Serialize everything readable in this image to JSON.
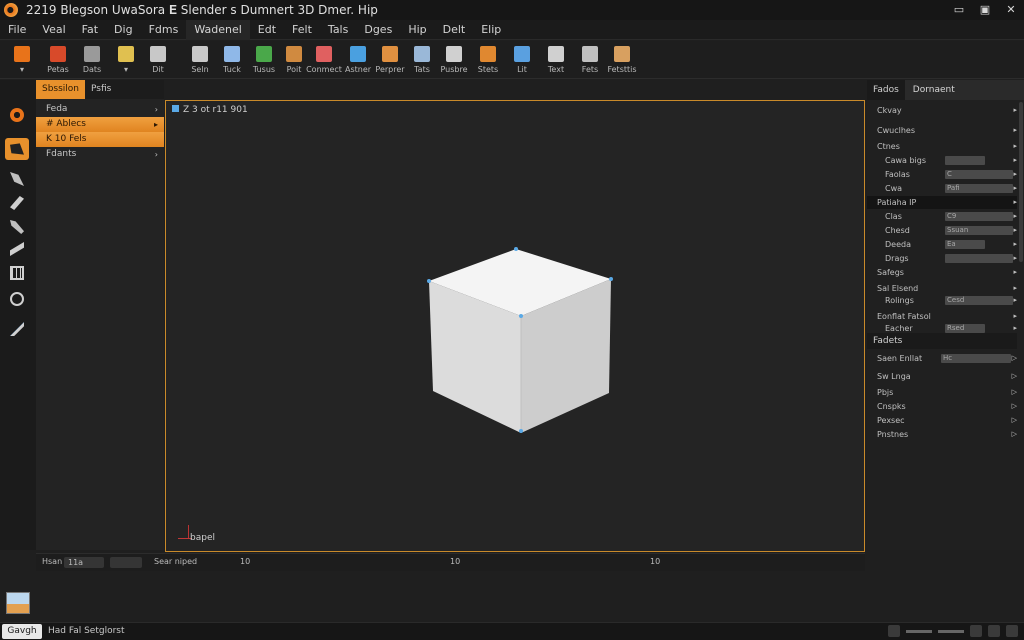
{
  "window": {
    "title": "2219 Blegson UwaSora 𝐄 Slender s Dumnert 3D Dmer. Hip"
  },
  "menu": [
    "File",
    "Veal",
    "Fat",
    "Dig",
    "Fdms",
    "Wadenel",
    "Edt",
    "Felt",
    "Tals",
    "Dges",
    "Hip",
    "Delt",
    "Elip"
  ],
  "toolbar": {
    "tools": [
      {
        "label": "▾",
        "color": "#e8731a"
      },
      {
        "label": "Petas",
        "color": "#d84a2a"
      },
      {
        "label": "Dats",
        "color": "#9a9a9a"
      },
      {
        "label": "▾",
        "color": "#e0c050"
      },
      {
        "label": "Dit",
        "color": "#c8c8c8"
      },
      {
        "label": "Seln",
        "color": "#c8c8c8"
      },
      {
        "label": "Tuck",
        "color": "#8fb8e8"
      },
      {
        "label": "Tusus",
        "color": "#4aa84a"
      },
      {
        "label": "Poit",
        "color": "#d08a40"
      },
      {
        "label": "Conmect",
        "color": "#e06060"
      },
      {
        "label": "Astner",
        "color": "#4aa0e0"
      },
      {
        "label": "Perprer",
        "color": "#e09040"
      },
      {
        "label": "Tats",
        "color": "#9ab8d8"
      },
      {
        "label": "Pusbre",
        "color": "#d0d0d0"
      },
      {
        "label": "Stets",
        "color": "#e08830"
      },
      {
        "label": "Lit",
        "color": "#5aa0e0"
      },
      {
        "label": "Text",
        "color": "#d0d0d0"
      },
      {
        "label": "Fets",
        "color": "#c0c0c0"
      },
      {
        "label": "Fetsttis",
        "color": "#d8a060"
      }
    ]
  },
  "outliner": {
    "tabs": [
      "Sbssilon",
      "Psfis"
    ],
    "rows": [
      {
        "label": "Feda",
        "arrow": "›"
      },
      {
        "label": "# Ablecs",
        "arrow": "▸"
      },
      {
        "label": "K 10 Fels",
        "arrow": ""
      },
      {
        "label": "Fdants",
        "arrow": "›"
      }
    ]
  },
  "viewport": {
    "label": "Z 3 ot r11 901",
    "axis_label": "bapel"
  },
  "properties": {
    "header_left": "Fados",
    "header_tab": "Dornaent",
    "rows": [
      {
        "key": "Ckvay",
        "type": "sec"
      },
      {
        "key": "Cwuclhes",
        "type": "sec"
      },
      {
        "key": "Ctnes",
        "type": "sec"
      },
      {
        "key": "Cawa bigs",
        "value": "",
        "type": "field"
      },
      {
        "key": "Faolas",
        "value": "C",
        "type": "field"
      },
      {
        "key": "Cwa",
        "value": "Pafi",
        "type": "field"
      },
      {
        "key": "Patiaha  IP",
        "type": "dark"
      },
      {
        "key": "Clas",
        "value": "C9",
        "type": "field"
      },
      {
        "key": "Chesd",
        "value": "Ssuan",
        "type": "field"
      },
      {
        "key": "Deeda",
        "value": "Ea",
        "type": "field"
      },
      {
        "key": "Drags",
        "value": "",
        "type": "field"
      },
      {
        "key": "Safegs",
        "type": "sec"
      },
      {
        "key": "Sal Elsend",
        "type": "sec"
      },
      {
        "key": "Rolings",
        "value": "Cesd",
        "type": "field"
      },
      {
        "key": "Eonflat Fatsol",
        "type": "sec"
      },
      {
        "key": "Eacher",
        "value": "Rsed",
        "type": "field"
      }
    ],
    "section2_title": "Fadets",
    "section2_rows": [
      {
        "key": "Saen Enllat",
        "value": "Hc"
      },
      {
        "key": "Sw Lnga",
        "value": ""
      },
      {
        "key": "Pbjs",
        "value": ""
      },
      {
        "key": "Cnspks",
        "value": ""
      },
      {
        "key": "Pexsec",
        "value": ""
      },
      {
        "key": "Pnstnes",
        "value": ""
      }
    ]
  },
  "timeline": {
    "field1_label": "Hsan",
    "field1_value": "11a",
    "status": "Sear niped",
    "ticks": [
      "10",
      "10",
      "10"
    ]
  },
  "statusbar": {
    "logo": "Gavgh",
    "text": "Had  Fal  Setglorst"
  }
}
